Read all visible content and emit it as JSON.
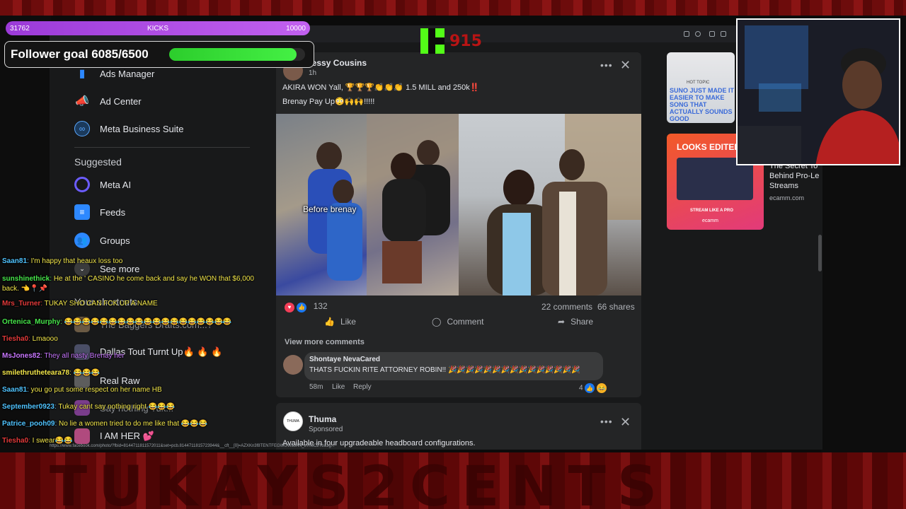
{
  "overlay": {
    "goal_start": "31762",
    "goal_label": "KICKS",
    "goal_end": "10000",
    "follower_goal_text": "Follower goal 6085/6500",
    "follower_goal_progress": 0.936,
    "kick_count": "915",
    "brand_banner": "TUKAYS2CENTS",
    "accent_green": "#53fc18",
    "accent_red": "#b81414"
  },
  "sidebar": {
    "items": [
      {
        "label": "Ads Manager",
        "icon": "bar-chart-icon"
      },
      {
        "label": "Ad Center",
        "icon": "megaphone-icon"
      },
      {
        "label": "Meta Business Suite",
        "icon": "meta-business-icon"
      }
    ],
    "suggested_title": "Suggested",
    "suggested": [
      {
        "label": "Meta AI",
        "icon": "meta-ai-icon"
      },
      {
        "label": "Feeds",
        "icon": "feeds-icon"
      },
      {
        "label": "Groups",
        "icon": "groups-icon"
      }
    ],
    "see_more": "See more",
    "shortcuts_title": "Your shortcuts",
    "shortcuts": [
      {
        "label": "The Baggers Drafts.com...?"
      },
      {
        "label": "Dallas Tout Turnt Up🔥 🔥 🔥"
      },
      {
        "label": "Real Raw"
      },
      {
        "label": "Say nothing Tuk..."
      },
      {
        "label": "I AM HER 💕"
      }
    ]
  },
  "post": {
    "author": "Jessy Cousins",
    "time": "1h",
    "line1": "AKIRA WON Yall, 🏆🏆🏆👏👏👏 1.5 MILL and 250k‼️",
    "line2": "Brenay Pay Up😳🙌🙌!!!!!",
    "photo_caption": "Before brenay",
    "reaction_count": "132",
    "comments_count": "22 comments",
    "shares_count": "66 shares",
    "like_label": "Like",
    "comment_label": "Comment",
    "share_label": "Share",
    "view_more_comments": "View more comments",
    "comment": {
      "author": "Shontaye NevaCared",
      "text": "THATS FUCKIN RITE ATTORNEY ROBIN!! 🎉🎉🎉🎉🎉🎉🎉🎉🎉🎉🎉🎉🎉🎉🎉",
      "time": "58m",
      "like": "Like",
      "reply": "Reply",
      "reactions": "4"
    }
  },
  "ad": {
    "brand_logo": "THUMA",
    "name": "Thuma",
    "sponsored": "Sponsored",
    "text": "Available in four upgradeable headboard configurations."
  },
  "right_ads": [
    {
      "headline": "SUNO JUST MADE IT EASIER TO MAKE SONG THAT ACTUALLY SOUNDS GOOD",
      "tag": "HOT TOPIC"
    },
    {
      "headline": "LOOKS EDITED. IT'S",
      "button": "STREAM LIKE A PRO",
      "brand": "ecamm",
      "title": "The Secret To Behind Pro-Le Streams",
      "domain": "ecamm.com"
    }
  ],
  "chat": [
    {
      "user": "Saan81",
      "msg": "I'm happy that heaux loss too",
      "color": "#4fc3ff",
      "msgcolor": "#f2e64a"
    },
    {
      "user": "sunshinethick",
      "msg": "He at the ' CASINO he come back and say he WON that $6,000 back. 👈📍📌",
      "color": "#46e64a",
      "msgcolor": "#f2e64a"
    },
    {
      "user": "Mrs_Turner",
      "msg": "TUKAY SHO CAN FCK UP A NAME",
      "color": "#e33a3a",
      "msgcolor": "#f2e64a"
    },
    {
      "user": "Ortenica_Murphy",
      "msg": "😂😂😂😂😂😂😂😂😂😂😂😂😂😂😂😂😂😂😂",
      "color": "#46e64a",
      "msgcolor": "#f2e64a"
    },
    {
      "user": "Tiesha0",
      "msg": "Lmaooo",
      "color": "#e33a3a",
      "msgcolor": "#f2e64a"
    },
    {
      "user": "MsJones82",
      "msg": "They all nasty Brenay her",
      "color": "#c977ff",
      "msgcolor": "#c977ff"
    },
    {
      "user": "smilethrutheteara78",
      "msg": "😂😂😂",
      "color": "#f2e64a",
      "msgcolor": "#f2e64a"
    },
    {
      "user": "Saan81",
      "msg": "you go put some respect on her name HB",
      "color": "#4fc3ff",
      "msgcolor": "#f2e64a"
    },
    {
      "user": "September0923",
      "msg": "Tukay cant say nothing right 😂😂😂",
      "color": "#4fc3ff",
      "msgcolor": "#f2e64a"
    },
    {
      "user": "Patrice_pooh09",
      "msg": "No lie a women tried to do me like that 😂😂😂",
      "color": "#4fc3ff",
      "msgcolor": "#f2e64a"
    },
    {
      "user": "Tiesha0",
      "msg": "I swear😂😂",
      "color": "#e33a3a",
      "msgcolor": "#f2e64a"
    }
  ],
  "status_url": "https://www.facebook.com/photo/?fbid=8144711811572011&set=pcb.8144711815723944&__cft__[0]=AZXKn3f8TENTFEGWGWbJAN_L7hoC2Tba1g..."
}
